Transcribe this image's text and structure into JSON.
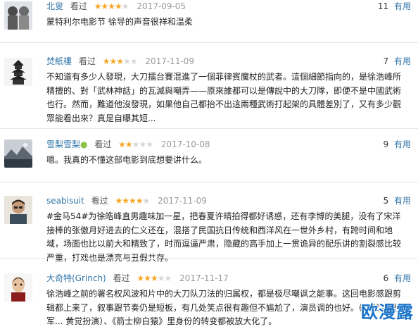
{
  "reviews": [
    {
      "user": "北叟",
      "seen": "看过",
      "rating": 4,
      "date": "2017-09-05",
      "votes": "11",
      "useful": "有用",
      "content": "蒙特利尔电影节 徐导的声音很祥和温柔"
    },
    {
      "user": "焚紙樓",
      "seen": "看过",
      "rating": 3,
      "date": "2017-11-09",
      "votes": "7",
      "useful": "有用",
      "content": "不知道有多少人發現，大刀擂台賽混進了一個菲律賓魔杖的武者。這個細節指向的，是徐浩峰所精擅的、對「武林神話」的瓦滅與嘲弄——原來誰都可以是傳說中的大刀隊，即便不是中國武術也行。然而，難道他沒發現，如果他自己都抬不出這兩種武術打起架的具體差別了，又有多少觀眾能看出來？真是自曝其短..."
    },
    {
      "user": "雪梨雪梨",
      "seen": "看过",
      "rating": 2,
      "date": "2017-10-08",
      "votes": "9",
      "useful": "有用",
      "content": "嗯。我真的不懂这部电影到底想要讲什么。"
    },
    {
      "user": "seabisuit",
      "seen": "看过",
      "rating": 4,
      "date": "2017-11-09",
      "votes": "5",
      "useful": "有用",
      "content": "#金马54#为徐皓峰直男趣味加一星，把春夏许晴拍得都好诱惑，还有李博的美腿，没有了宋洋接棒的张傲月好进去的仁义还在，混搭了民国抗日传统和西洋风在一世外乡村，有跨时间和地域，场面也比以前大和精致了，时而逗逼严肃，隐藏的高手加上一贯诡异的配乐讲的割裂感比较严重，打戏也是漂亮与丑假共存。"
    },
    {
      "user": "大奇特(Grinch)",
      "seen": "看过",
      "rating": 3,
      "date": "2017-11-17",
      "votes": "6",
      "useful": "有用",
      "content": "徐浩峰之前的署名权风波和片中的大刀队刀法的归属权，都是极尽嘲讽之能事。这回电影感跟剪辑都上来了，叙事跟节奏仍是短板，有几处笑点很有趣但不尴尬了，演员调的也好。《师父》里的军... 黄觉扮演）、《箭士柳白猿》里身份的转变都被放大化了。"
    }
  ],
  "watermark": "欧漫露",
  "colors": {
    "link": "#3377aa",
    "star": "#f5a623",
    "star_off": "#d6d6d6",
    "watermark": "#1a73c8"
  }
}
